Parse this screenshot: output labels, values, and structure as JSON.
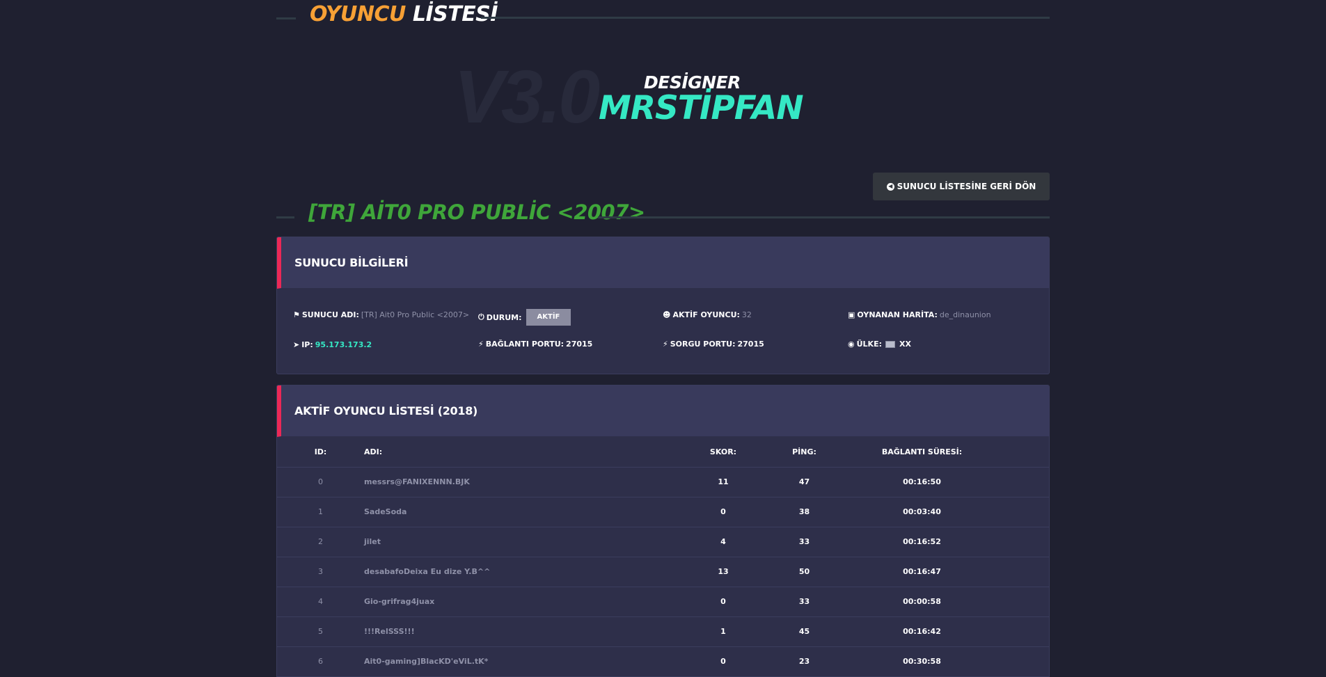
{
  "players_header": {
    "word1": "OYUNCU",
    "word2": "LİSTESİ"
  },
  "designer": {
    "version": "V3.0",
    "label": "DESİGNER",
    "name": "MRSTİPFAN"
  },
  "back_button": {
    "label": "SUNUCU LİSTESİNE GERİ DÖN",
    "icon": "arrow-circle-left-icon"
  },
  "server_title": "[TR] AİT0 PRO PUBLİC <2007>",
  "server_info": {
    "title": "SUNUCU BİLGİLERİ",
    "name_label": "SUNUCU ADI:",
    "name_value": "[TR] Ait0 Pro Public <2007>",
    "status_label": "DURUM:",
    "status_value": "AKTİF",
    "active_label": "AKTİF OYUNCU:",
    "active_value": "32",
    "map_label": "OYNANAN HARİTA:",
    "map_value": "de_dinaunion",
    "ip_label": "IP:",
    "ip_value": "95.173.173.2",
    "conn_port_label": "BAĞLANTI PORTU:",
    "conn_port_value": "27015",
    "query_port_label": "SORGU PORTU:",
    "query_port_value": "27015",
    "country_label": "ÜLKE:",
    "country_value": "XX"
  },
  "player_list": {
    "title": "AKTİF OYUNCU LİSTESİ (2018)",
    "columns": {
      "id": "ID:",
      "name": "ADI:",
      "score": "SKOR:",
      "ping": "PİNG:",
      "conn": "BAĞLANTI SÜRESİ:"
    },
    "rows": [
      {
        "id": "0",
        "name": "messrs@FANIXENNN.BJK",
        "score": "11",
        "ping": "47",
        "conn": "00:16:50"
      },
      {
        "id": "1",
        "name": "SadeSoda",
        "score": "0",
        "ping": "38",
        "conn": "00:03:40"
      },
      {
        "id": "2",
        "name": "jilet",
        "score": "4",
        "ping": "33",
        "conn": "00:16:52"
      },
      {
        "id": "3",
        "name": "desabafoDeixa Eu dize Y.B^^",
        "score": "13",
        "ping": "50",
        "conn": "00:16:47"
      },
      {
        "id": "4",
        "name": "Gio-grifrag4juax",
        "score": "0",
        "ping": "33",
        "conn": "00:00:58"
      },
      {
        "id": "5",
        "name": "!!!RelSSS!!!",
        "score": "1",
        "ping": "45",
        "conn": "00:16:42"
      },
      {
        "id": "6",
        "name": "Ait0-gaming]BlacKD'eViL.tK*",
        "score": "0",
        "ping": "23",
        "conn": "00:30:58"
      }
    ]
  }
}
